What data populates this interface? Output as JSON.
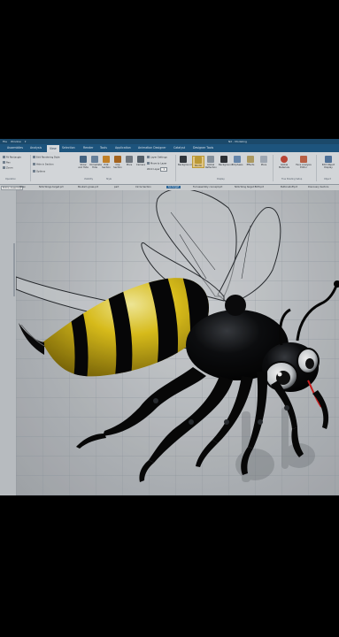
{
  "app": {
    "window_title": "NX - Modeling",
    "quick_access": [
      "File",
      "Window",
      "▾"
    ]
  },
  "tabs": [
    {
      "label": "Assemblies"
    },
    {
      "label": "Analysis"
    },
    {
      "label": "View"
    },
    {
      "label": "Selection"
    },
    {
      "label": "Render"
    },
    {
      "label": "Tools"
    },
    {
      "label": "Application"
    },
    {
      "label": "Animation Designer"
    },
    {
      "label": "Catalyst"
    },
    {
      "label": "Designer Tools"
    }
  ],
  "ribbon": {
    "left_tools": [
      "Fit Rectangle",
      "Pan",
      "Zoom"
    ],
    "view_items": [
      "Edit Rendering Style",
      "Hide in Section",
      "Options"
    ],
    "buttons": [
      {
        "label": "Show and Hide",
        "color": "#4a6a8a"
      },
      {
        "label": "Immediate Hide",
        "color": "#6f8aa6"
      },
      {
        "label": "Edit Section",
        "color": "#d08a2a"
      },
      {
        "label": "Clip Section",
        "color": "#b06a20"
      },
      {
        "label": "More",
        "color": "#777f88"
      },
      {
        "label": "Camera",
        "color": "#5a6570"
      },
      {
        "label": "Background",
        "color": "#353a40"
      },
      {
        "label": "Studio",
        "color": "#c9a43a"
      },
      {
        "label": "Global Reflection",
        "color": "#8e9aa6"
      },
      {
        "label": "Background",
        "color": "#2f3338"
      },
      {
        "label": "Emphasis",
        "color": "#6e90b8"
      },
      {
        "label": "Effects",
        "color": "#b8a468"
      },
      {
        "label": "More",
        "color": "#aab4bf"
      },
      {
        "label": "Global Materials",
        "color": "#c64a3a"
      },
      {
        "label": "Face Analysis Editor",
        "color": "#c6674a"
      },
      {
        "label": "Edit Object Display",
        "color": "#5579a3"
      }
    ],
    "layer_items": [
      "Layer Settings",
      "Move to Layer",
      "Work Layer"
    ],
    "work_layer_value": "1",
    "groups": [
      "Operation",
      "Visibility",
      "Style",
      "Display",
      "True Shading Setup",
      "Object"
    ]
  },
  "selection_bar": {
    "filter_label": "Entire Assembly",
    "items": [
      "Open",
      "NXG Wings target.prt",
      "Bz-stem grass.prt",
      "part",
      "Circle Section",
      "bp-target",
      "Full assembly concept.prt",
      "NXG Wing target BUM.prt",
      "Buttonstuff.prt",
      "Discovery Sectors"
    ],
    "active_index": 5
  },
  "colors": {
    "title_bg": "#1d4f72",
    "tab_bg": "#1f5a86",
    "bee_yellow": "#e0c21a",
    "bee_black": "#0c0c0e",
    "stinger": "#d81f1f"
  }
}
